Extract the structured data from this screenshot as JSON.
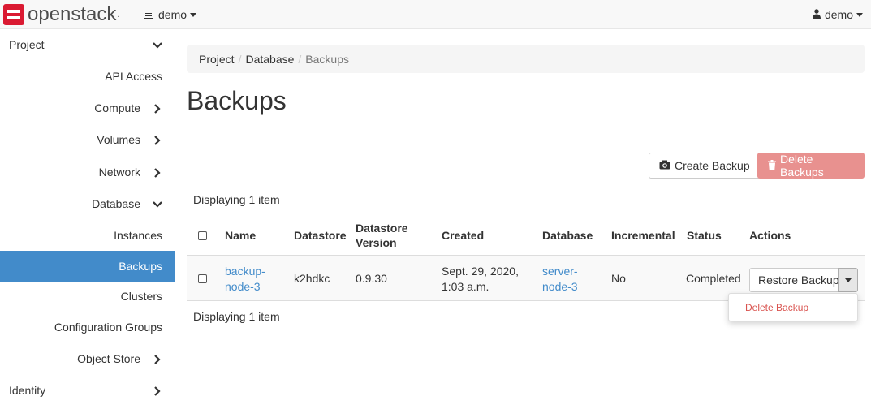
{
  "brand": {
    "name": "openstack",
    "trademark": "."
  },
  "topbar": {
    "project_label": "demo",
    "user_label": "demo"
  },
  "sidebar": {
    "items": [
      {
        "label": "Project",
        "chevron": "down"
      },
      {
        "label": "API Access",
        "chevron": ""
      },
      {
        "label": "Compute",
        "chevron": "right"
      },
      {
        "label": "Volumes",
        "chevron": "right"
      },
      {
        "label": "Network",
        "chevron": "right"
      },
      {
        "label": "Database",
        "chevron": "down"
      },
      {
        "label": "Instances",
        "chevron": ""
      },
      {
        "label": "Backups",
        "chevron": "",
        "active": true
      },
      {
        "label": "Clusters",
        "chevron": ""
      },
      {
        "label": "Configuration Groups",
        "chevron": ""
      },
      {
        "label": "Object Store",
        "chevron": "right"
      },
      {
        "label": "Identity",
        "chevron": "right"
      }
    ]
  },
  "breadcrumb": {
    "items": [
      "Project",
      "Database",
      "Backups"
    ],
    "separator": "/"
  },
  "page": {
    "title": "Backups"
  },
  "actions": {
    "create_label": "Create Backup",
    "delete_label": "Delete Backups"
  },
  "table": {
    "display_count_top": "Displaying 1 item",
    "display_count_bottom": "Displaying 1 item",
    "headers": {
      "name": "Name",
      "datastore": "Datastore",
      "datastore_version_1": "Datastore",
      "datastore_version_2": "Version",
      "created": "Created",
      "database": "Database",
      "incremental": "Incremental",
      "status": "Status",
      "actions": "Actions"
    },
    "rows": [
      {
        "name_1": "backup-",
        "name_2": "node-3",
        "datastore": "k2hdkc",
        "datastore_version": "0.9.30",
        "created_1": "Sept. 29, 2020,",
        "created_2": "1:03 a.m.",
        "database_1": "server-",
        "database_2": "node-3",
        "incremental": "No",
        "status": "Completed",
        "action_label": "Restore Backup"
      }
    ]
  },
  "row_menu": {
    "items": [
      "Delete Backup"
    ]
  },
  "colors": {
    "brand_red": "#da1a32",
    "link": "#428bca",
    "active_nav": "#428bca",
    "danger": "#d9534f",
    "danger_disabled": "#e8918f"
  }
}
